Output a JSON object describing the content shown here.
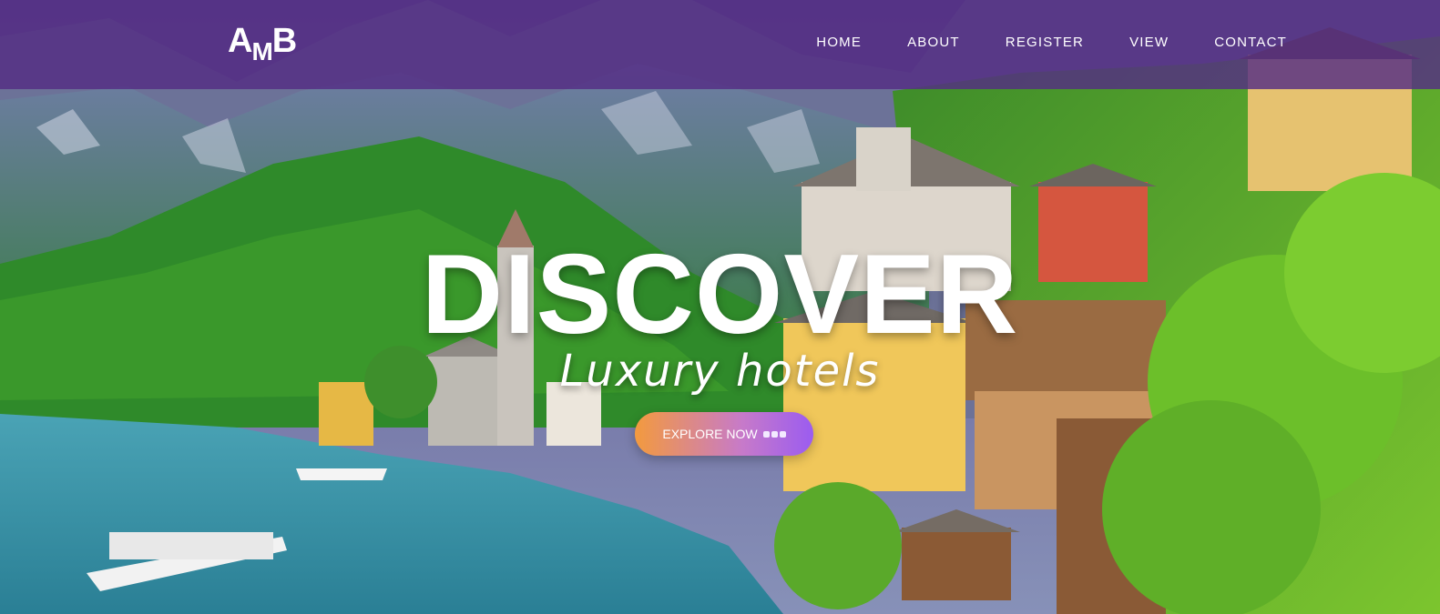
{
  "header": {
    "logo_main_1": "A",
    "logo_sub": "M",
    "logo_main_2": "B",
    "nav": [
      {
        "label": "HOME"
      },
      {
        "label": "ABOUT"
      },
      {
        "label": "REGISTER"
      },
      {
        "label": "VIEW"
      },
      {
        "label": "CONTACT"
      }
    ]
  },
  "hero": {
    "headline": "DISCOVER",
    "subheadline": "Luxury hotels",
    "cta_label": "EXPLORE NOW",
    "cta_icon": "dots-icon"
  },
  "colors": {
    "navbar": "#542d84",
    "cta_start": "#f39a3e",
    "cta_end": "#9b5cf0"
  }
}
